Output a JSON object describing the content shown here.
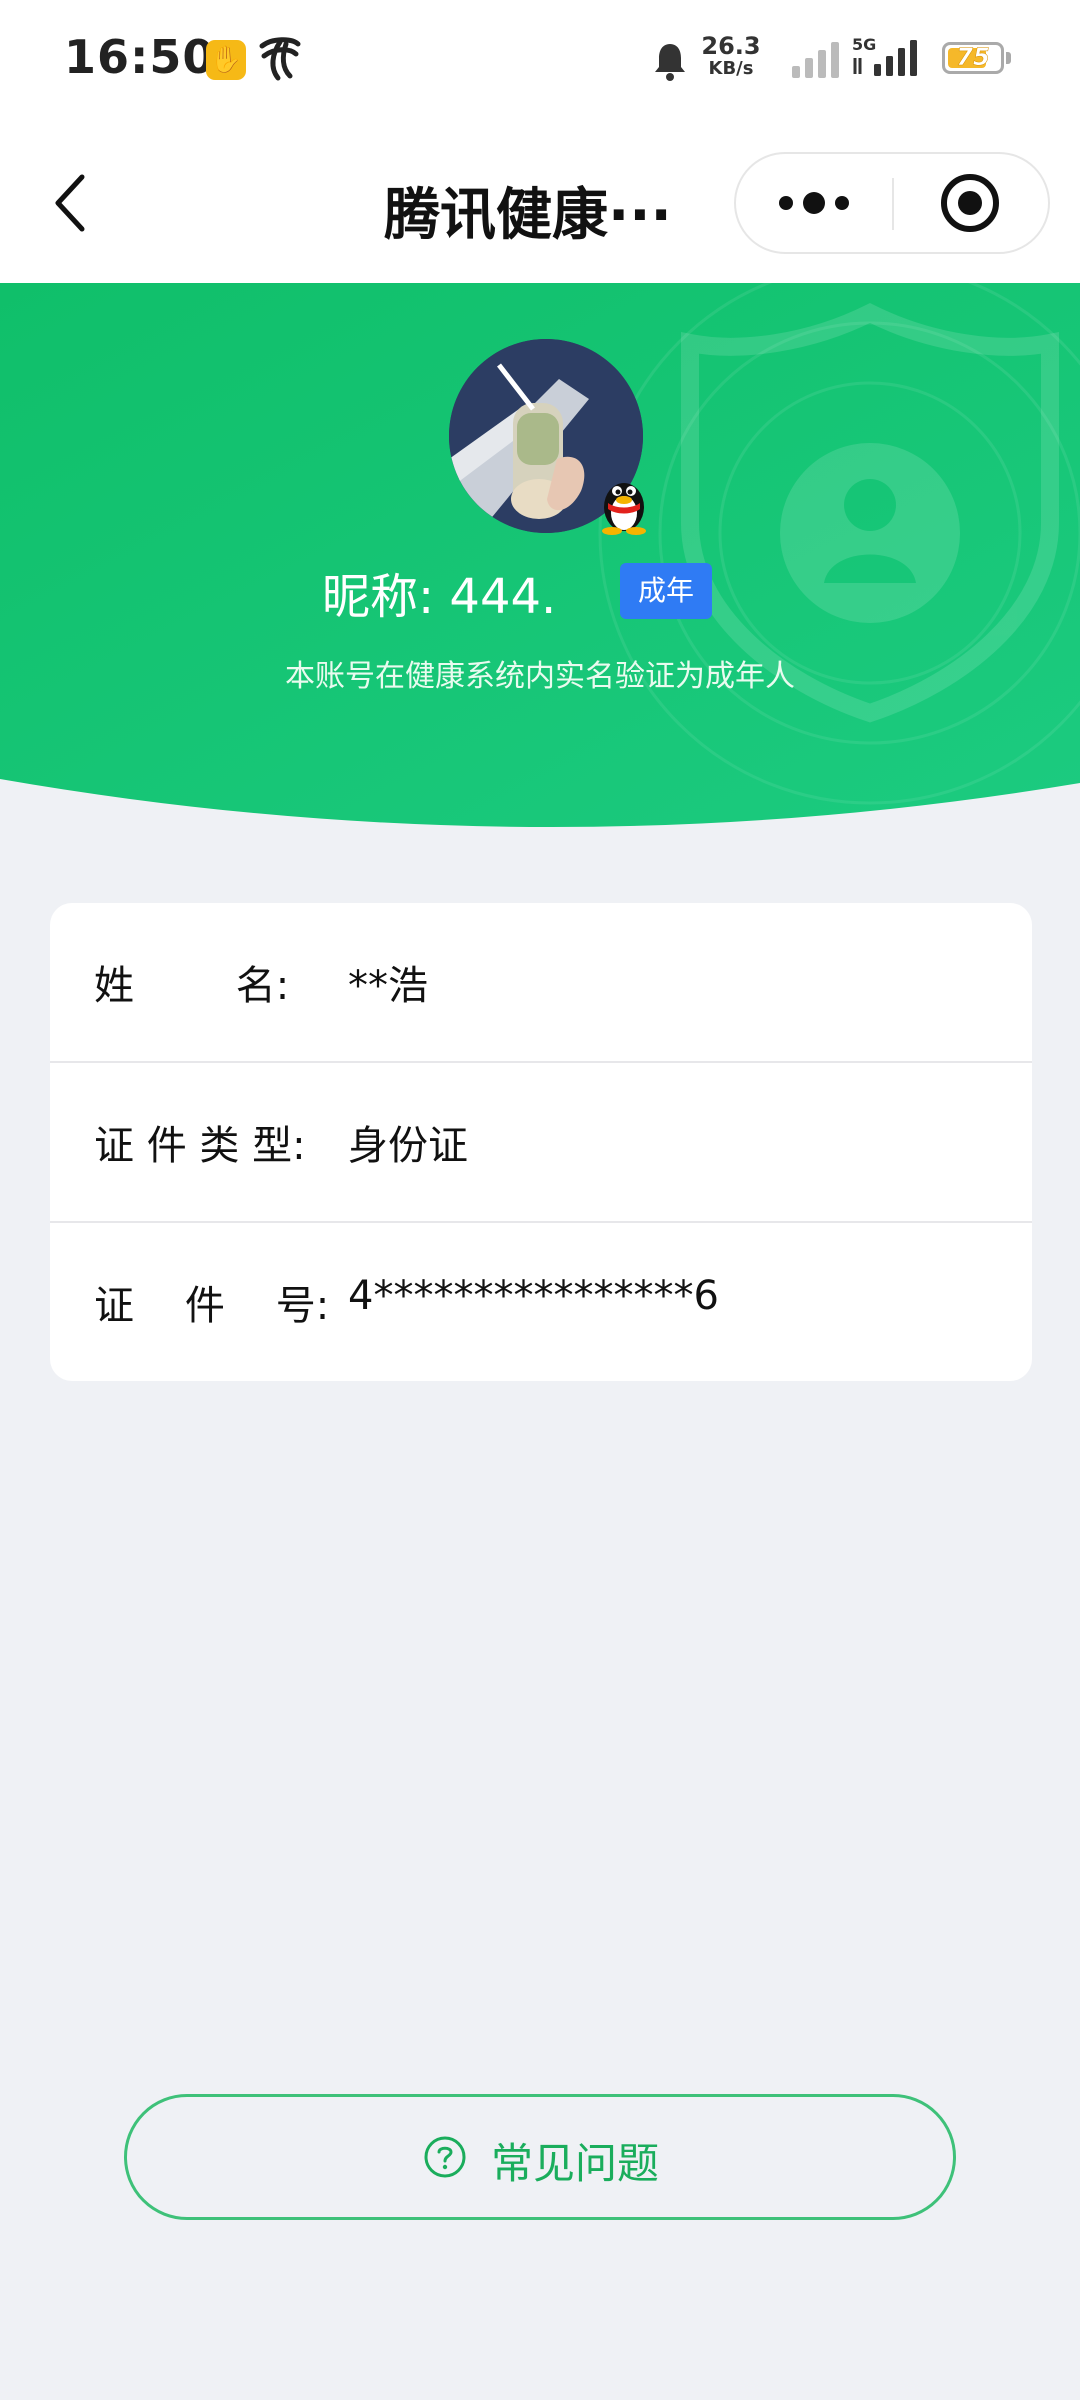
{
  "status_bar": {
    "time": "16:50",
    "net_speed_value": "26.3",
    "net_speed_unit": "KB/s",
    "network_type": "5G",
    "battery_level": "75",
    "battery_fraction": 0.75
  },
  "nav": {
    "title": "腾讯健康···",
    "back_icon": "chevron-left-icon",
    "more_icon": "more-dots-icon",
    "close_icon": "target-close-icon"
  },
  "profile": {
    "nickname": "昵称:  444.",
    "adult_badge": "成年",
    "verify_text": "本账号在健康系统内实名验证为成年人"
  },
  "info": {
    "rows": [
      {
        "label": "姓        名:",
        "value": "**浩"
      },
      {
        "label": "证 件 类 型:",
        "value": "身份证"
      },
      {
        "label": "证    件    号:",
        "value": "4****************6"
      }
    ]
  },
  "faq": {
    "label": "常见问题",
    "icon": "question-circle-icon"
  },
  "colors": {
    "hero_green": "#16c172",
    "page_bg": "#eff1f5",
    "badge_blue": "#2f7bf4",
    "faq_green": "#1aad5c"
  }
}
